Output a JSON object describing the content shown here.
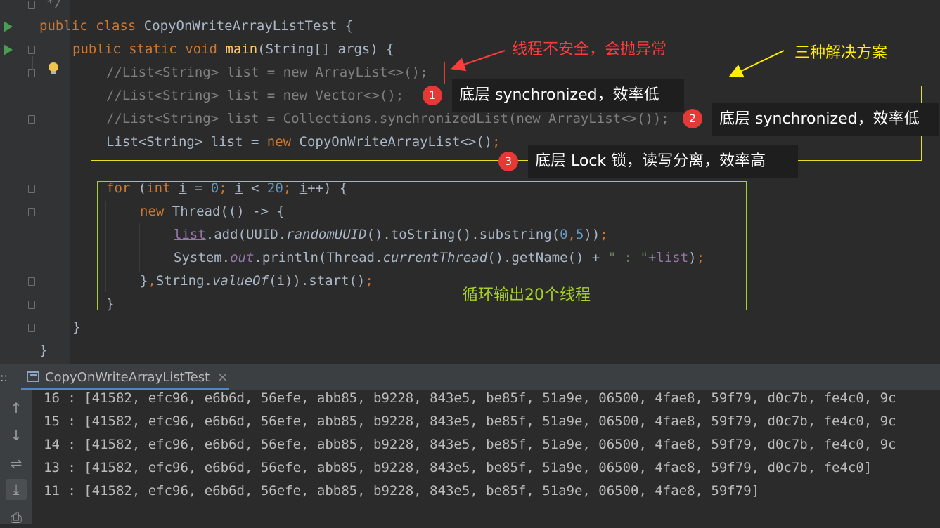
{
  "editor": {
    "comment_end": "*/",
    "class_line": {
      "kw_public": "public",
      "kw_class": "class",
      "class_name": "CopyOnWriteArrayListTest",
      "brace": " {"
    },
    "main_line": {
      "kw_public": "public",
      "kw_static": "static",
      "kw_void": "void",
      "method": "main",
      "params": "(String[] args) {"
    },
    "line_arraylist": "//List<String> list = new ArrayList<>();",
    "line_vector": "//List<String> list = new Vector<>();",
    "line_synclist": "//List<String> list = Collections.synchronizedList(new ArrayList<>());",
    "line_cow": {
      "a": "List<String> list = ",
      "kw_new": "new",
      "b": " CopyOnWriteArrayList<>()",
      "semi": ";"
    },
    "for_line": {
      "kw_for": "for",
      "a": " (",
      "kw_int": "int",
      "b": " ",
      "i1": "i",
      "c": " = ",
      "n0": "0",
      "s1": ";",
      "d": " ",
      "i2": "i",
      "e": " < ",
      "n20": "20",
      "s2": ";",
      "f": " ",
      "i3": "i",
      "g": "++) {"
    },
    "thread_line": {
      "kw_new": "new",
      "rest": " Thread(() -> {"
    },
    "add_line": {
      "list": "list",
      "a": ".add(UUID.",
      "rand": "randomUUID",
      "b": "().toString().substring(",
      "n0": "0",
      "comma": ",",
      "n5": "5",
      "c": "))",
      "semi": ";"
    },
    "println_line": {
      "a": "System.",
      "out": "out",
      "b": ".println(Thread.",
      "ct": "currentThread",
      "c": "().getName() + ",
      "str": "\" : \"",
      "d": "+",
      "list": "list",
      "e": ")",
      "semi": ";"
    },
    "close_thread": {
      "a": "}",
      "comma": ",",
      "b": "String.",
      "valueof": "valueOf",
      "c": "(",
      "i": "i",
      "d": ")).start()",
      "semi": ";"
    },
    "close_for": "}",
    "close_main": "}",
    "close_class": "}"
  },
  "annotations": {
    "unsafe": "线程不安全，会抛异常",
    "three_solutions": "三种解决方案",
    "callout1": "底层 synchronized，效率低",
    "callout2": "底层 synchronized，效率低",
    "callout3": "底层 Lock 锁，读写分离，效率高",
    "badge1": "1",
    "badge2": "2",
    "badge3": "3",
    "loop_note": "循环输出20个线程"
  },
  "run_panel": {
    "label": "::",
    "tab_title": "CopyOnWriteArrayListTest",
    "tab_close": "×"
  },
  "console": {
    "lines": [
      "16 : [41582, efc96, e6b6d, 56efe, abb85, b9228, 843e5, be85f, 51a9e, 06500, 4fae8, 59f79, d0c7b, fe4c0, 9c",
      "15 : [41582, efc96, e6b6d, 56efe, abb85, b9228, 843e5, be85f, 51a9e, 06500, 4fae8, 59f79, d0c7b, fe4c0, 9c",
      "14 : [41582, efc96, e6b6d, 56efe, abb85, b9228, 843e5, be85f, 51a9e, 06500, 4fae8, 59f79, d0c7b, fe4c0, 9c",
      "13 : [41582, efc96, e6b6d, 56efe, abb85, b9228, 843e5, be85f, 51a9e, 06500, 4fae8, 59f79, d0c7b, fe4c0]",
      "11 : [41582, efc96, e6b6d, 56efe, abb85, b9228, 843e5, be85f, 51a9e, 06500, 4fae8, 59f79]"
    ]
  },
  "colors": {
    "annotation_red": "#ff3b3b",
    "annotation_yellow": "#ffee00",
    "annotation_green": "#a5d025",
    "badge_red": "#e53935"
  }
}
